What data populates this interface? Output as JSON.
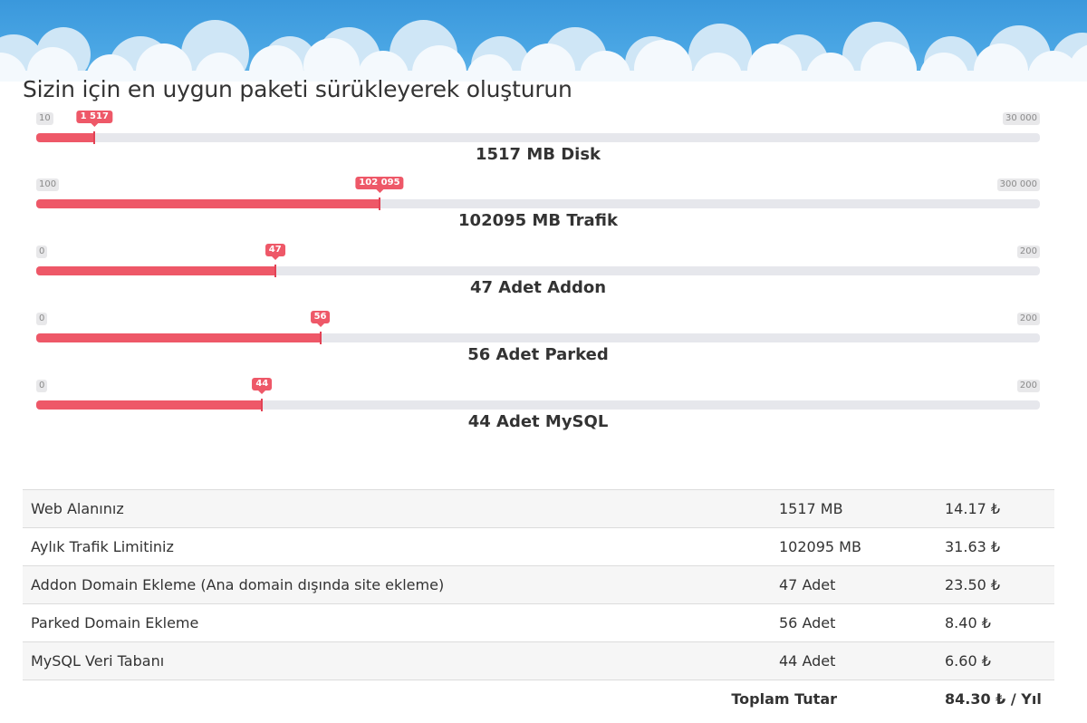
{
  "title": "Sizin için en uygun paketi sürükleyerek oluşturun",
  "colors": {
    "accent": "#ee5868",
    "sky": "#3a98dc",
    "track": "#e6e7ec"
  },
  "sliders": [
    {
      "id": "disk",
      "min": 10,
      "max": 300000,
      "min_label": "10",
      "max_label": "30 000",
      "value": 1517,
      "value_label": "1 517",
      "fill_fraction": 0.058,
      "caption": "1517 MB Disk"
    },
    {
      "id": "trafik",
      "min": 100,
      "max": 300000,
      "min_label": "100",
      "max_label": "300 000",
      "value": 102095,
      "value_label": "102 095",
      "fill_fraction": 0.342,
      "caption": "102095 MB Trafik"
    },
    {
      "id": "addon",
      "min": 0,
      "max": 200,
      "min_label": "0",
      "max_label": "200",
      "value": 47,
      "value_label": "47",
      "fill_fraction": 0.238,
      "caption": "47 Adet Addon"
    },
    {
      "id": "parked",
      "min": 0,
      "max": 200,
      "min_label": "0",
      "max_label": "200",
      "value": 56,
      "value_label": "56",
      "fill_fraction": 0.283,
      "caption": "56 Adet Parked"
    },
    {
      "id": "mysql",
      "min": 0,
      "max": 200,
      "min_label": "0",
      "max_label": "200",
      "value": 44,
      "value_label": "44",
      "fill_fraction": 0.225,
      "caption": "44 Adet MySQL"
    }
  ],
  "summary": {
    "rows": [
      {
        "name": "Web Alanınız",
        "qty": "1517 MB",
        "price": "14.17 ₺"
      },
      {
        "name": "Aylık Trafik Limitiniz",
        "qty": "102095 MB",
        "price": "31.63 ₺"
      },
      {
        "name": "Addon Domain Ekleme (Ana domain dışında site ekleme)",
        "qty": "47 Adet",
        "price": "23.50 ₺"
      },
      {
        "name": "Parked Domain Ekleme",
        "qty": "56 Adet",
        "price": "8.40 ₺"
      },
      {
        "name": "MySQL Veri Tabanı",
        "qty": "44 Adet",
        "price": "6.60 ₺"
      }
    ],
    "total_label": "Toplam Tutar",
    "total_value": "84.30 ₺ / Yıl"
  }
}
